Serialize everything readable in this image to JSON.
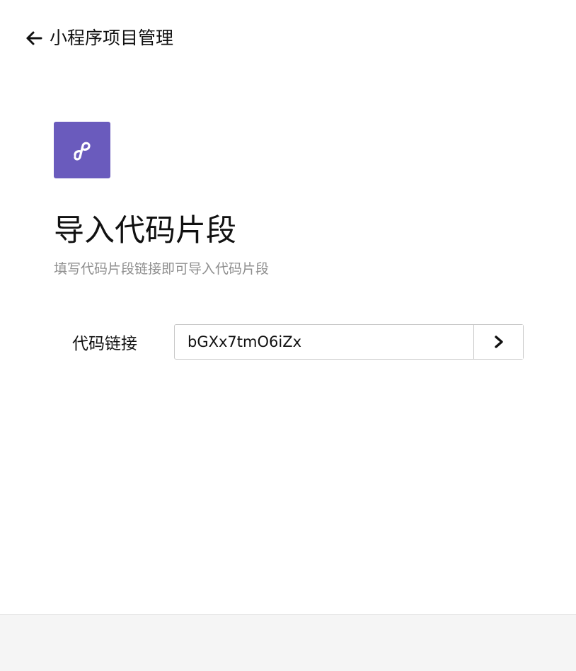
{
  "header": {
    "back_icon": "arrow-left-icon",
    "title": "小程序项目管理"
  },
  "logo": {
    "icon": "mini-program-icon",
    "color": "#6A5BBD"
  },
  "main": {
    "title": "导入代码片段",
    "subtitle": "填写代码片段链接即可导入代码片段"
  },
  "form": {
    "label": "代码链接",
    "link_value": "bGXx7tmO6iZx",
    "submit_icon": "chevron-right-icon"
  },
  "colors": {
    "accent": "#6A5BBD",
    "subtitle": "#8F8F8F",
    "footer": "#F5F5F5"
  }
}
